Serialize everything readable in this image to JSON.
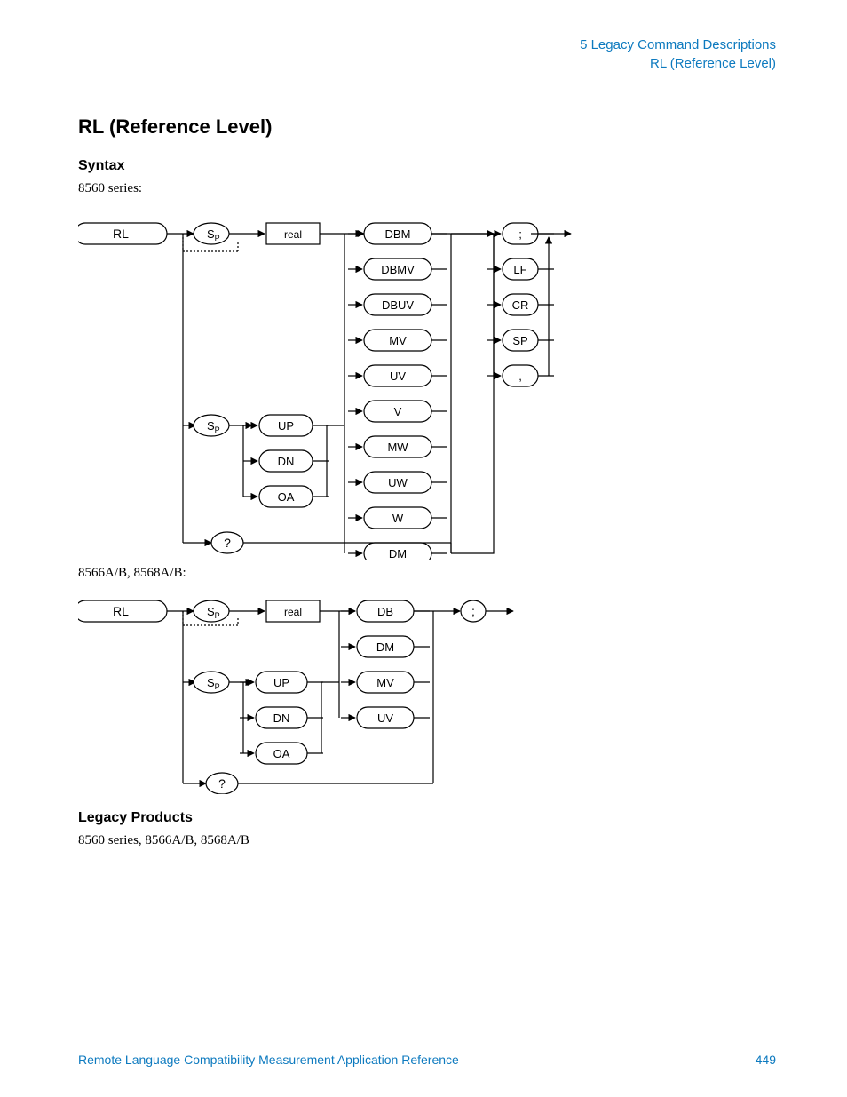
{
  "header": {
    "chapter": "5  Legacy Command Descriptions",
    "section": "RL (Reference Level)"
  },
  "title": "RL (Reference Level)",
  "syntax_heading": "Syntax",
  "series1_label": "8560 series:",
  "series2_label": "8566A/B, 8568A/B:",
  "legacy_heading": "Legacy Products",
  "legacy_text": "8560 series, 8566A/B, 8568A/B",
  "footer": {
    "doc": "Remote Language Compatibility Measurement Application Reference",
    "page": "449"
  },
  "diagram1": {
    "start": "RL",
    "sp": "S",
    "sp_sub": "P",
    "real": "real",
    "units": [
      "DBM",
      "DBMV",
      "DBUV",
      "MV",
      "UV",
      "V",
      "MW",
      "UW",
      "W",
      "DM"
    ],
    "steps": [
      "UP",
      "DN",
      "OA"
    ],
    "query": "?",
    "terms": [
      ";",
      "LF",
      "CR",
      "SP",
      ","
    ]
  },
  "diagram2": {
    "start": "RL",
    "sp": "S",
    "sp_sub": "P",
    "real": "real",
    "units": [
      "DB",
      "DM",
      "MV",
      "UV"
    ],
    "steps": [
      "UP",
      "DN",
      "OA"
    ],
    "query": "?",
    "term": ";"
  }
}
